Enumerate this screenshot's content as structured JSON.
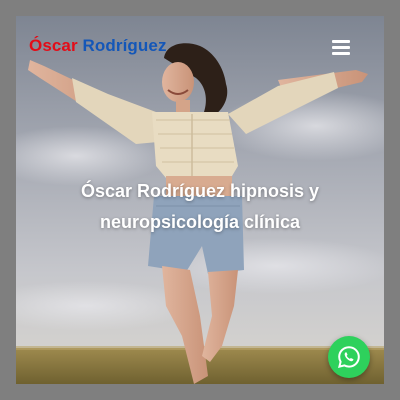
{
  "header": {
    "brand_first": "Óscar",
    "brand_last": "Rodríguez",
    "menu_icon": "hamburger-menu-icon"
  },
  "hero": {
    "title": "Óscar Rodríguez hipnosis y neuropsicología clínica",
    "photo_description": "woman with arms outstretched in a field"
  },
  "floating": {
    "whatsapp_icon": "whatsapp-icon"
  },
  "colors": {
    "brand_first": "#e30d18",
    "brand_last": "#1457b8",
    "whatsapp_green": "#2ed15c",
    "title_text": "#ffffff"
  }
}
